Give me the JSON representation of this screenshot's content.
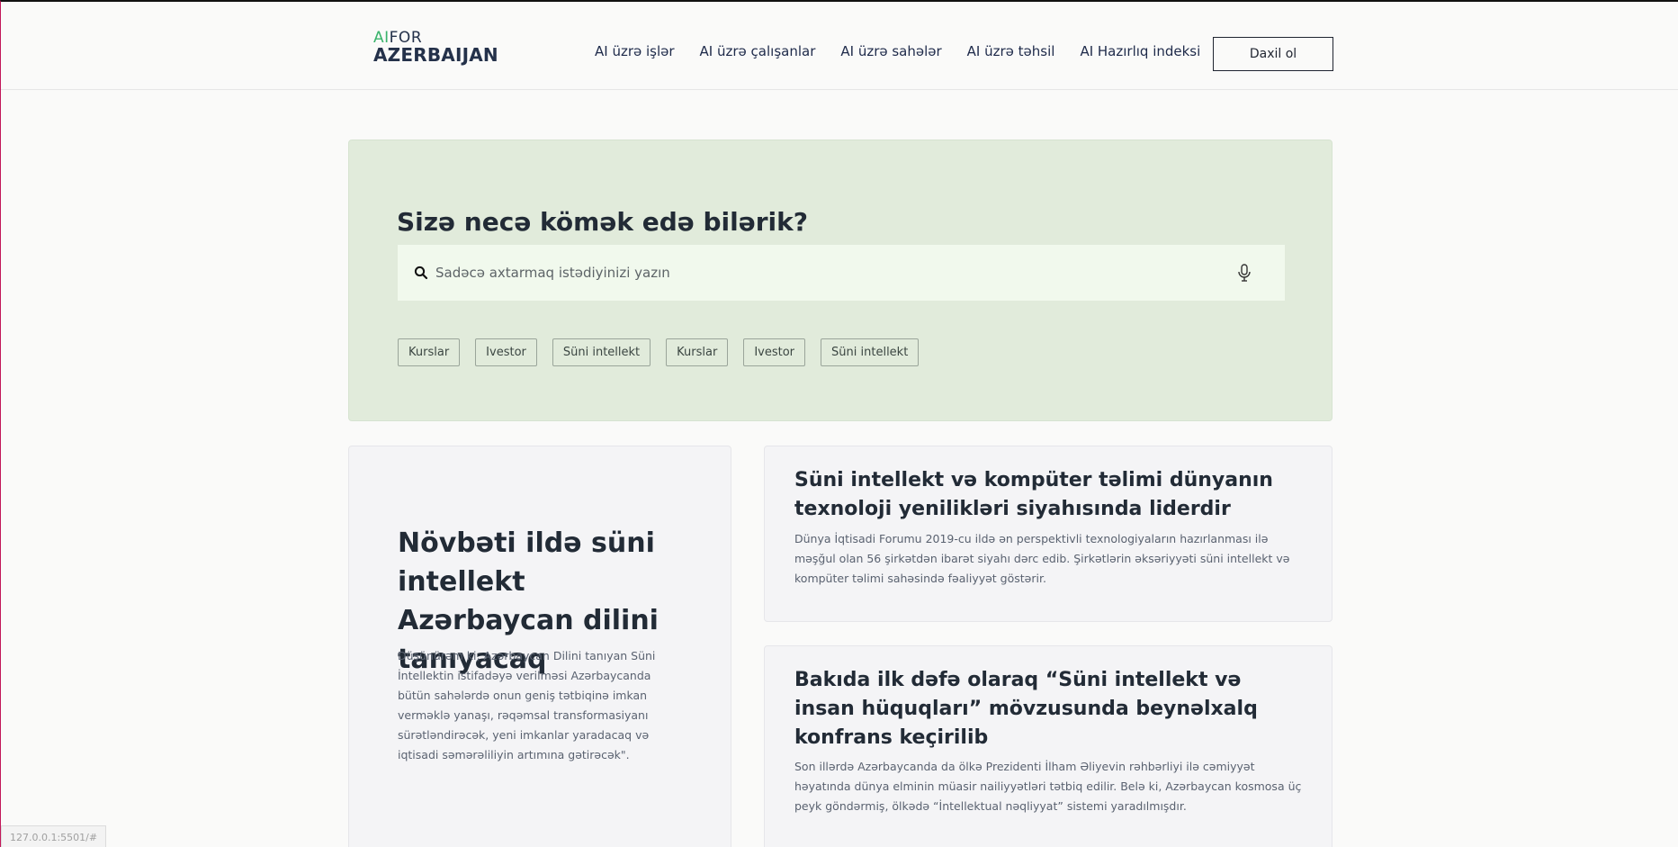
{
  "header": {
    "logo_ai": "AI",
    "logo_for": "FOR",
    "logo_country": "AZERBAIJAN",
    "nav": [
      {
        "label": "AI üzrə işlər"
      },
      {
        "label": "AI üzrə çalışanlar"
      },
      {
        "label": "AI üzrə sahələr"
      },
      {
        "label": "AI üzrə təhsil"
      },
      {
        "label": "AI Hazırlıq indeksi"
      }
    ],
    "login_label": "Daxil ol"
  },
  "hero": {
    "title": "Sizə necə kömək edə bilərik?",
    "search_placeholder": "Sadəcə axtarmaq istədiyinizi yazın",
    "search_icon": "search-icon",
    "mic_icon": "microphone-icon",
    "chips": [
      "Kurslar",
      "Ivestor",
      "Süni intellekt",
      "Kurslar",
      "Ivestor",
      "Süni intellekt"
    ]
  },
  "articles": {
    "main": {
      "title": "Növbəti ildə süni intellekt Azərbaycan dilini tanıyacaq",
      "body": "Düşünürəm ki, Azərbaycan Dilini tanıyan Süni İntellektin istifadəyə verilməsi Azərbaycanda bütün sahələrdə onun geniş tətbiqinə imkan verməklə yanaşı, rəqəmsal transformasiyanı sürətləndirəcək, yeni imkanlar yaradacaq və iqtisadi səmərəliliyin artımına gətirəcək\"."
    },
    "first": {
      "title": "Süni intellekt və kompüter təlimi dünyanın texnoloji yenilikləri siyahısında liderdir",
      "body": "Dünya İqtisadi Forumu 2019-cu ildə ən perspektivli texnologiyaların hazırlanması ilə məşğul olan 56 şirkətdən ibarət siyahı dərc edib. Şirkətlərin əksəriyyəti süni intellekt və kompüter təlimi sahəsində fəaliyyət göstərir."
    },
    "second": {
      "title": "Bakıda ilk dəfə olaraq “Süni intellekt və insan hüquqları” mövzusunda beynəlxalq konfrans keçirilib",
      "body": "Son illərdə Azərbaycanda da ölkə Prezidenti İlham Əliyevin rəhbərliyi ilə cəmiyyət həyatında dünya elminin müasir nailiyyətləri tətbiq edilir. Belə ki, Azərbaycan kosmosa üç peyk göndərmiş, ölkədə “İntellektual nəqliyyat” sistemi yaradılmışdır."
    }
  },
  "status_url": "127.0.0.1:5501/#"
}
